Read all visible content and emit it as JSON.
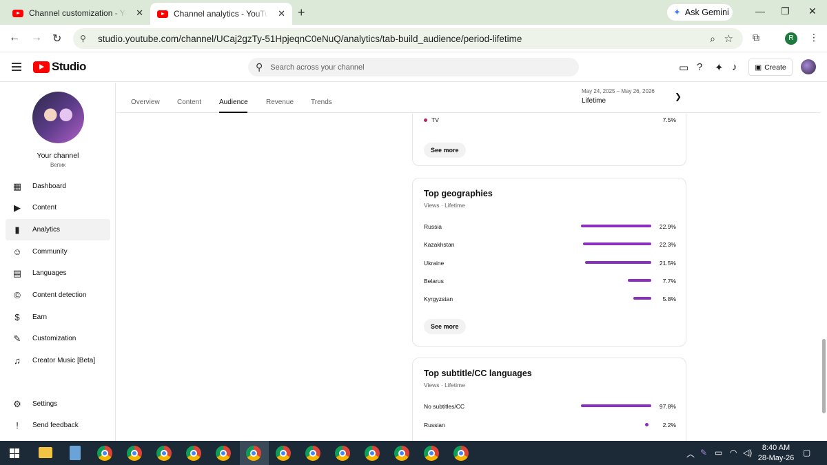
{
  "browser": {
    "tabs": [
      {
        "title": "Channel customization - YouTube Studio",
        "close": "✕"
      },
      {
        "title": "Channel analytics - YouTube Studio",
        "close": "✕"
      }
    ],
    "new_tab": "+",
    "ask_gemini": "Ask Gemini",
    "url": "studio.youtube.com/channel/UCaj2gzTy-51HpjeqnC0eNuQ/analytics/tab-build_audience/period-lifetime",
    "profile_initial": "R"
  },
  "studio": {
    "logo_text": "Studio",
    "search_placeholder": "Search across your channel",
    "create_label": "Create"
  },
  "sidebar": {
    "channel_name": "Your channel",
    "channel_sub": "Вепик",
    "items": [
      {
        "label": "Dashboard",
        "icon": "dashboard-icon",
        "glyph": "▦"
      },
      {
        "label": "Content",
        "icon": "content-icon",
        "glyph": "▶"
      },
      {
        "label": "Analytics",
        "icon": "analytics-icon",
        "glyph": "▮"
      },
      {
        "label": "Community",
        "icon": "community-icon",
        "glyph": "☺"
      },
      {
        "label": "Languages",
        "icon": "languages-icon",
        "glyph": "▤"
      },
      {
        "label": "Content detection",
        "icon": "copyright-icon",
        "glyph": "©"
      },
      {
        "label": "Earn",
        "icon": "earn-icon",
        "glyph": "$"
      },
      {
        "label": "Customization",
        "icon": "customization-icon",
        "glyph": "✎"
      },
      {
        "label": "Creator Music [Beta]",
        "icon": "music-icon",
        "glyph": "♫"
      },
      {
        "label": "Settings",
        "icon": "settings-icon",
        "glyph": "⚙"
      },
      {
        "label": "Send feedback",
        "icon": "feedback-icon",
        "glyph": "!"
      }
    ]
  },
  "analytics_tabs": [
    "Overview",
    "Content",
    "Audience",
    "Revenue",
    "Trends"
  ],
  "active_tab": "Audience",
  "date_range": "May 24, 2025 – May 26, 2026",
  "period": "Lifetime",
  "top_card": {
    "row_label": "TV",
    "row_value": "7.5%",
    "see_more": "See more"
  },
  "geographies": {
    "title": "Top geographies",
    "meta": "Views · Lifetime",
    "rows": [
      {
        "label": "Russia",
        "value": "22.9%",
        "share": 22.9
      },
      {
        "label": "Kazakhstan",
        "value": "22.3%",
        "share": 22.3
      },
      {
        "label": "Ukraine",
        "value": "21.5%",
        "share": 21.5
      },
      {
        "label": "Belarus",
        "value": "7.7%",
        "share": 7.7
      },
      {
        "label": "Kyrgyzstan",
        "value": "5.8%",
        "share": 5.8
      }
    ],
    "see_more": "See more"
  },
  "subtitles": {
    "title": "Top subtitle/CC languages",
    "meta": "Views · Lifetime",
    "rows": [
      {
        "label": "No subtitles/CC",
        "value": "97.8%",
        "share": 97.8
      },
      {
        "label": "Russian",
        "value": "2.2%",
        "share": 2.2
      }
    ]
  },
  "colors": {
    "bar": "#8b2fbd",
    "brand": "#ff0000"
  },
  "taskbar": {
    "time": "8:40 AM",
    "date": "28-May-26"
  }
}
